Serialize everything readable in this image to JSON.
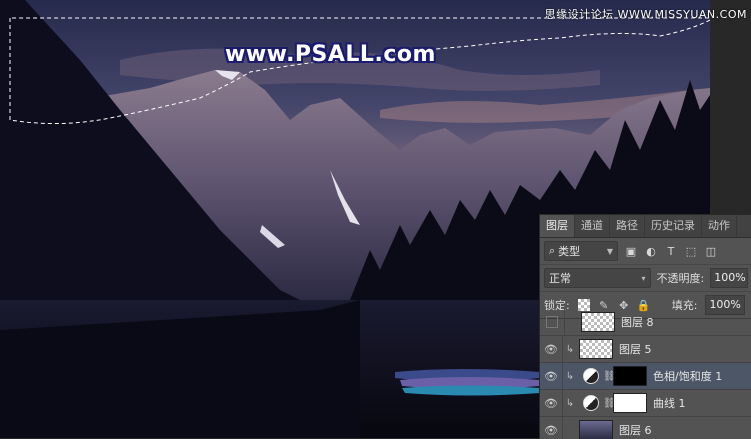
{
  "watermark": {
    "site_cn": "思缘设计论坛 WWW.MISSYUAN.COM",
    "main": "www.PSALL.com"
  },
  "panel": {
    "tabs": [
      {
        "label": "图层",
        "active": true
      },
      {
        "label": "通道",
        "active": false
      },
      {
        "label": "路径",
        "active": false
      },
      {
        "label": "历史记录",
        "active": false
      },
      {
        "label": "动作",
        "active": false
      }
    ],
    "filter": {
      "kind_label": "类型",
      "search_glyph": "⌕"
    },
    "blend": {
      "mode": "正常",
      "opacity_label": "不透明度:",
      "opacity_value": "100%"
    },
    "lock": {
      "label": "锁定:",
      "fill_label": "填充:",
      "fill_value": "100%"
    },
    "layers": [
      {
        "name": "图层 8",
        "visible": false,
        "clipped": false,
        "type": "pixel",
        "selected": false
      },
      {
        "name": "图层 5",
        "visible": true,
        "clipped": true,
        "type": "pixel",
        "selected": false
      },
      {
        "name": "色相/饱和度 1",
        "visible": true,
        "clipped": true,
        "type": "adjustment",
        "selected": true
      },
      {
        "name": "曲线 1",
        "visible": true,
        "clipped": true,
        "type": "adjustment",
        "selected": false
      },
      {
        "name": "图层 6",
        "visible": true,
        "clipped": false,
        "type": "photo",
        "selected": false
      }
    ]
  },
  "colors": {
    "panel_bg": "#535353",
    "selected_row": "#4c5667",
    "sky_dusk": "#2e3556"
  }
}
